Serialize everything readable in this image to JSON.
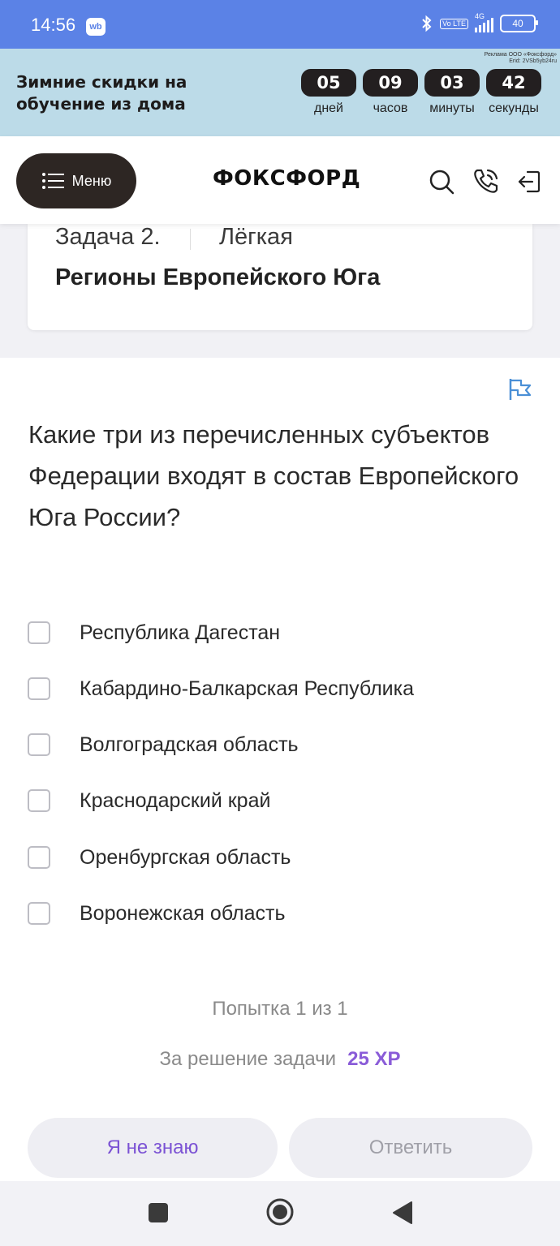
{
  "status_bar": {
    "time": "14:56",
    "wb_badge": "wb",
    "volte": "Vo LTE",
    "network": "4G",
    "battery": "40",
    "icons": [
      "bluetooth-icon",
      "signal-icon",
      "battery-icon"
    ]
  },
  "promo": {
    "title_line1": "Зимние скидки на",
    "title_line2": "обучение из дома",
    "ad_line1": "Реклама ООО «Фоксфорд»",
    "ad_line2": "Erid: 2VSb5yb24ru",
    "timer": [
      {
        "value": "05",
        "label": "дней"
      },
      {
        "value": "09",
        "label": "часов"
      },
      {
        "value": "03",
        "label": "минуты"
      },
      {
        "value": "42",
        "label": "секунды"
      }
    ]
  },
  "header": {
    "menu_label": "Меню",
    "logo": "ФОКСФОРД",
    "icons": [
      "search-icon",
      "phone-icon",
      "logout-icon"
    ]
  },
  "task": {
    "number": "Задача 2.",
    "difficulty": "Лёгкая",
    "title": "Регионы Европейского Юга"
  },
  "question": {
    "text": "Какие три из перечисленных субъектов Федерации входят в состав Европейского Юга России?",
    "options": [
      {
        "label": "Республика Дагестан",
        "checked": false
      },
      {
        "label": "Кабардино-Балкарская Республика",
        "checked": false
      },
      {
        "label": "Волгоградская область",
        "checked": false
      },
      {
        "label": "Краснодарский край",
        "checked": false
      },
      {
        "label": "Оренбургская область",
        "checked": false
      },
      {
        "label": "Воронежская область",
        "checked": false
      }
    ]
  },
  "footer": {
    "attempt": "Попытка 1 из 1",
    "reward_label": "За решение задачи",
    "reward_xp": "25 XP",
    "dont_know_button": "Я не знаю",
    "answer_button": "Ответить"
  },
  "colors": {
    "status_bar": "#5b82e6",
    "promo_bg": "#bcdbe8",
    "accent_purple": "#7b52d4",
    "flag_blue": "#4a8fd6"
  }
}
